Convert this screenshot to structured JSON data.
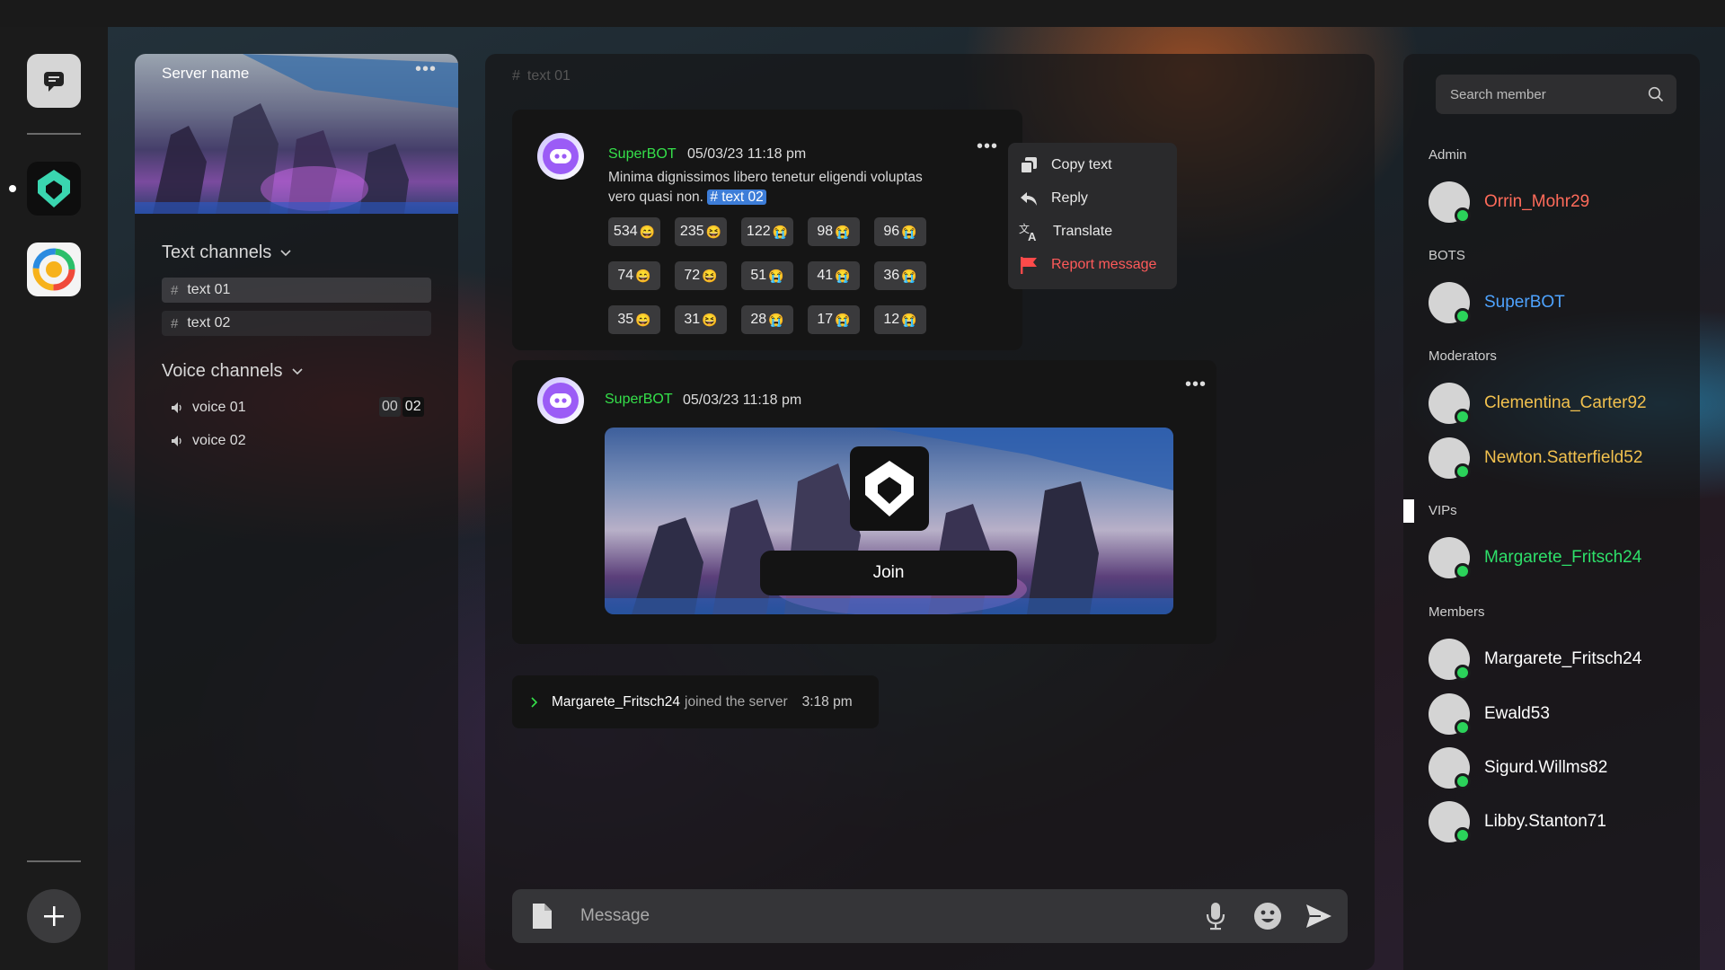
{
  "server": {
    "name": "Server name",
    "text_channels_label": "Text channels",
    "voice_channels_label": "Voice channels",
    "text_channels": [
      {
        "name": "text 01",
        "selected": true
      },
      {
        "name": "text 02",
        "selected": false
      }
    ],
    "voice_channels": [
      {
        "name": "voice 01",
        "timer_min": "00",
        "timer_sec": "02"
      },
      {
        "name": "voice 02"
      }
    ]
  },
  "channel_header": {
    "hash": "#",
    "name": "text 01"
  },
  "messages": [
    {
      "author": "SuperBOT",
      "timestamp": "05/03/23 11:18 pm",
      "text_line1": "Minima dignissimos libero tenetur eligendi voluptas",
      "text_line2": "vero quasi non.",
      "mention": "# text 02",
      "reactions": [
        {
          "count": "534",
          "emoji": "😄"
        },
        {
          "count": "235",
          "emoji": "😆"
        },
        {
          "count": "122",
          "emoji": "😭"
        },
        {
          "count": "98",
          "emoji": "😭"
        },
        {
          "count": "96",
          "emoji": "😭"
        },
        {
          "count": "74",
          "emoji": "😄"
        },
        {
          "count": "72",
          "emoji": "😆"
        },
        {
          "count": "51",
          "emoji": "😭"
        },
        {
          "count": "41",
          "emoji": "😭"
        },
        {
          "count": "36",
          "emoji": "😭"
        },
        {
          "count": "35",
          "emoji": "😄"
        },
        {
          "count": "31",
          "emoji": "😆"
        },
        {
          "count": "28",
          "emoji": "😭"
        },
        {
          "count": "17",
          "emoji": "😭"
        },
        {
          "count": "12",
          "emoji": "😭"
        }
      ]
    },
    {
      "author": "SuperBOT",
      "timestamp": "05/03/23 11:18 pm",
      "invite_button": "Join"
    }
  ],
  "context_menu": {
    "copy": "Copy text",
    "reply": "Reply",
    "translate": "Translate",
    "report": "Report message"
  },
  "system_message": {
    "user": "Margarete_Fritsch24",
    "action": "joined the server",
    "time": "3:18 pm"
  },
  "composer": {
    "placeholder": "Message"
  },
  "members": {
    "search_placeholder": "Search member",
    "groups": [
      {
        "label": "Admin",
        "users": [
          {
            "name": "Orrin_Mohr29",
            "color": "#ff6b5a"
          }
        ]
      },
      {
        "label": "BOTS",
        "users": [
          {
            "name": "SuperBOT",
            "color": "#4ea3ff"
          }
        ]
      },
      {
        "label": "Moderators",
        "users": [
          {
            "name": "Clementina_Carter92",
            "color": "#f2c14e"
          },
          {
            "name": "Newton.Satterfield52",
            "color": "#f2c14e"
          }
        ]
      },
      {
        "label": "VIPs",
        "users": [
          {
            "name": "Margarete_Fritsch24",
            "color": "#2ee06a"
          }
        ]
      },
      {
        "label": "Members",
        "users": [
          {
            "name": "Margarete_Fritsch24",
            "color": "#ffffff"
          },
          {
            "name": "Ewald53",
            "color": "#ffffff"
          },
          {
            "name": "Sigurd.Willms82",
            "color": "#ffffff"
          },
          {
            "name": "Libby.Stanton71",
            "color": "#ffffff"
          }
        ]
      }
    ]
  },
  "colors": {
    "online": "#2bd35a",
    "username_bot": "#35e04a",
    "mention_bg": "#3d7dd8",
    "danger": "#ff5a5a"
  },
  "icons": [
    "chat-icon",
    "server-shield-icon",
    "server-ring-icon",
    "add-icon",
    "more-icon",
    "chevron-down-icon",
    "speaker-icon",
    "copy-icon",
    "reply-icon",
    "translate-icon",
    "flag-icon",
    "file-icon",
    "mic-icon",
    "emoji-icon",
    "send-icon",
    "search-icon",
    "chevron-right-icon"
  ]
}
